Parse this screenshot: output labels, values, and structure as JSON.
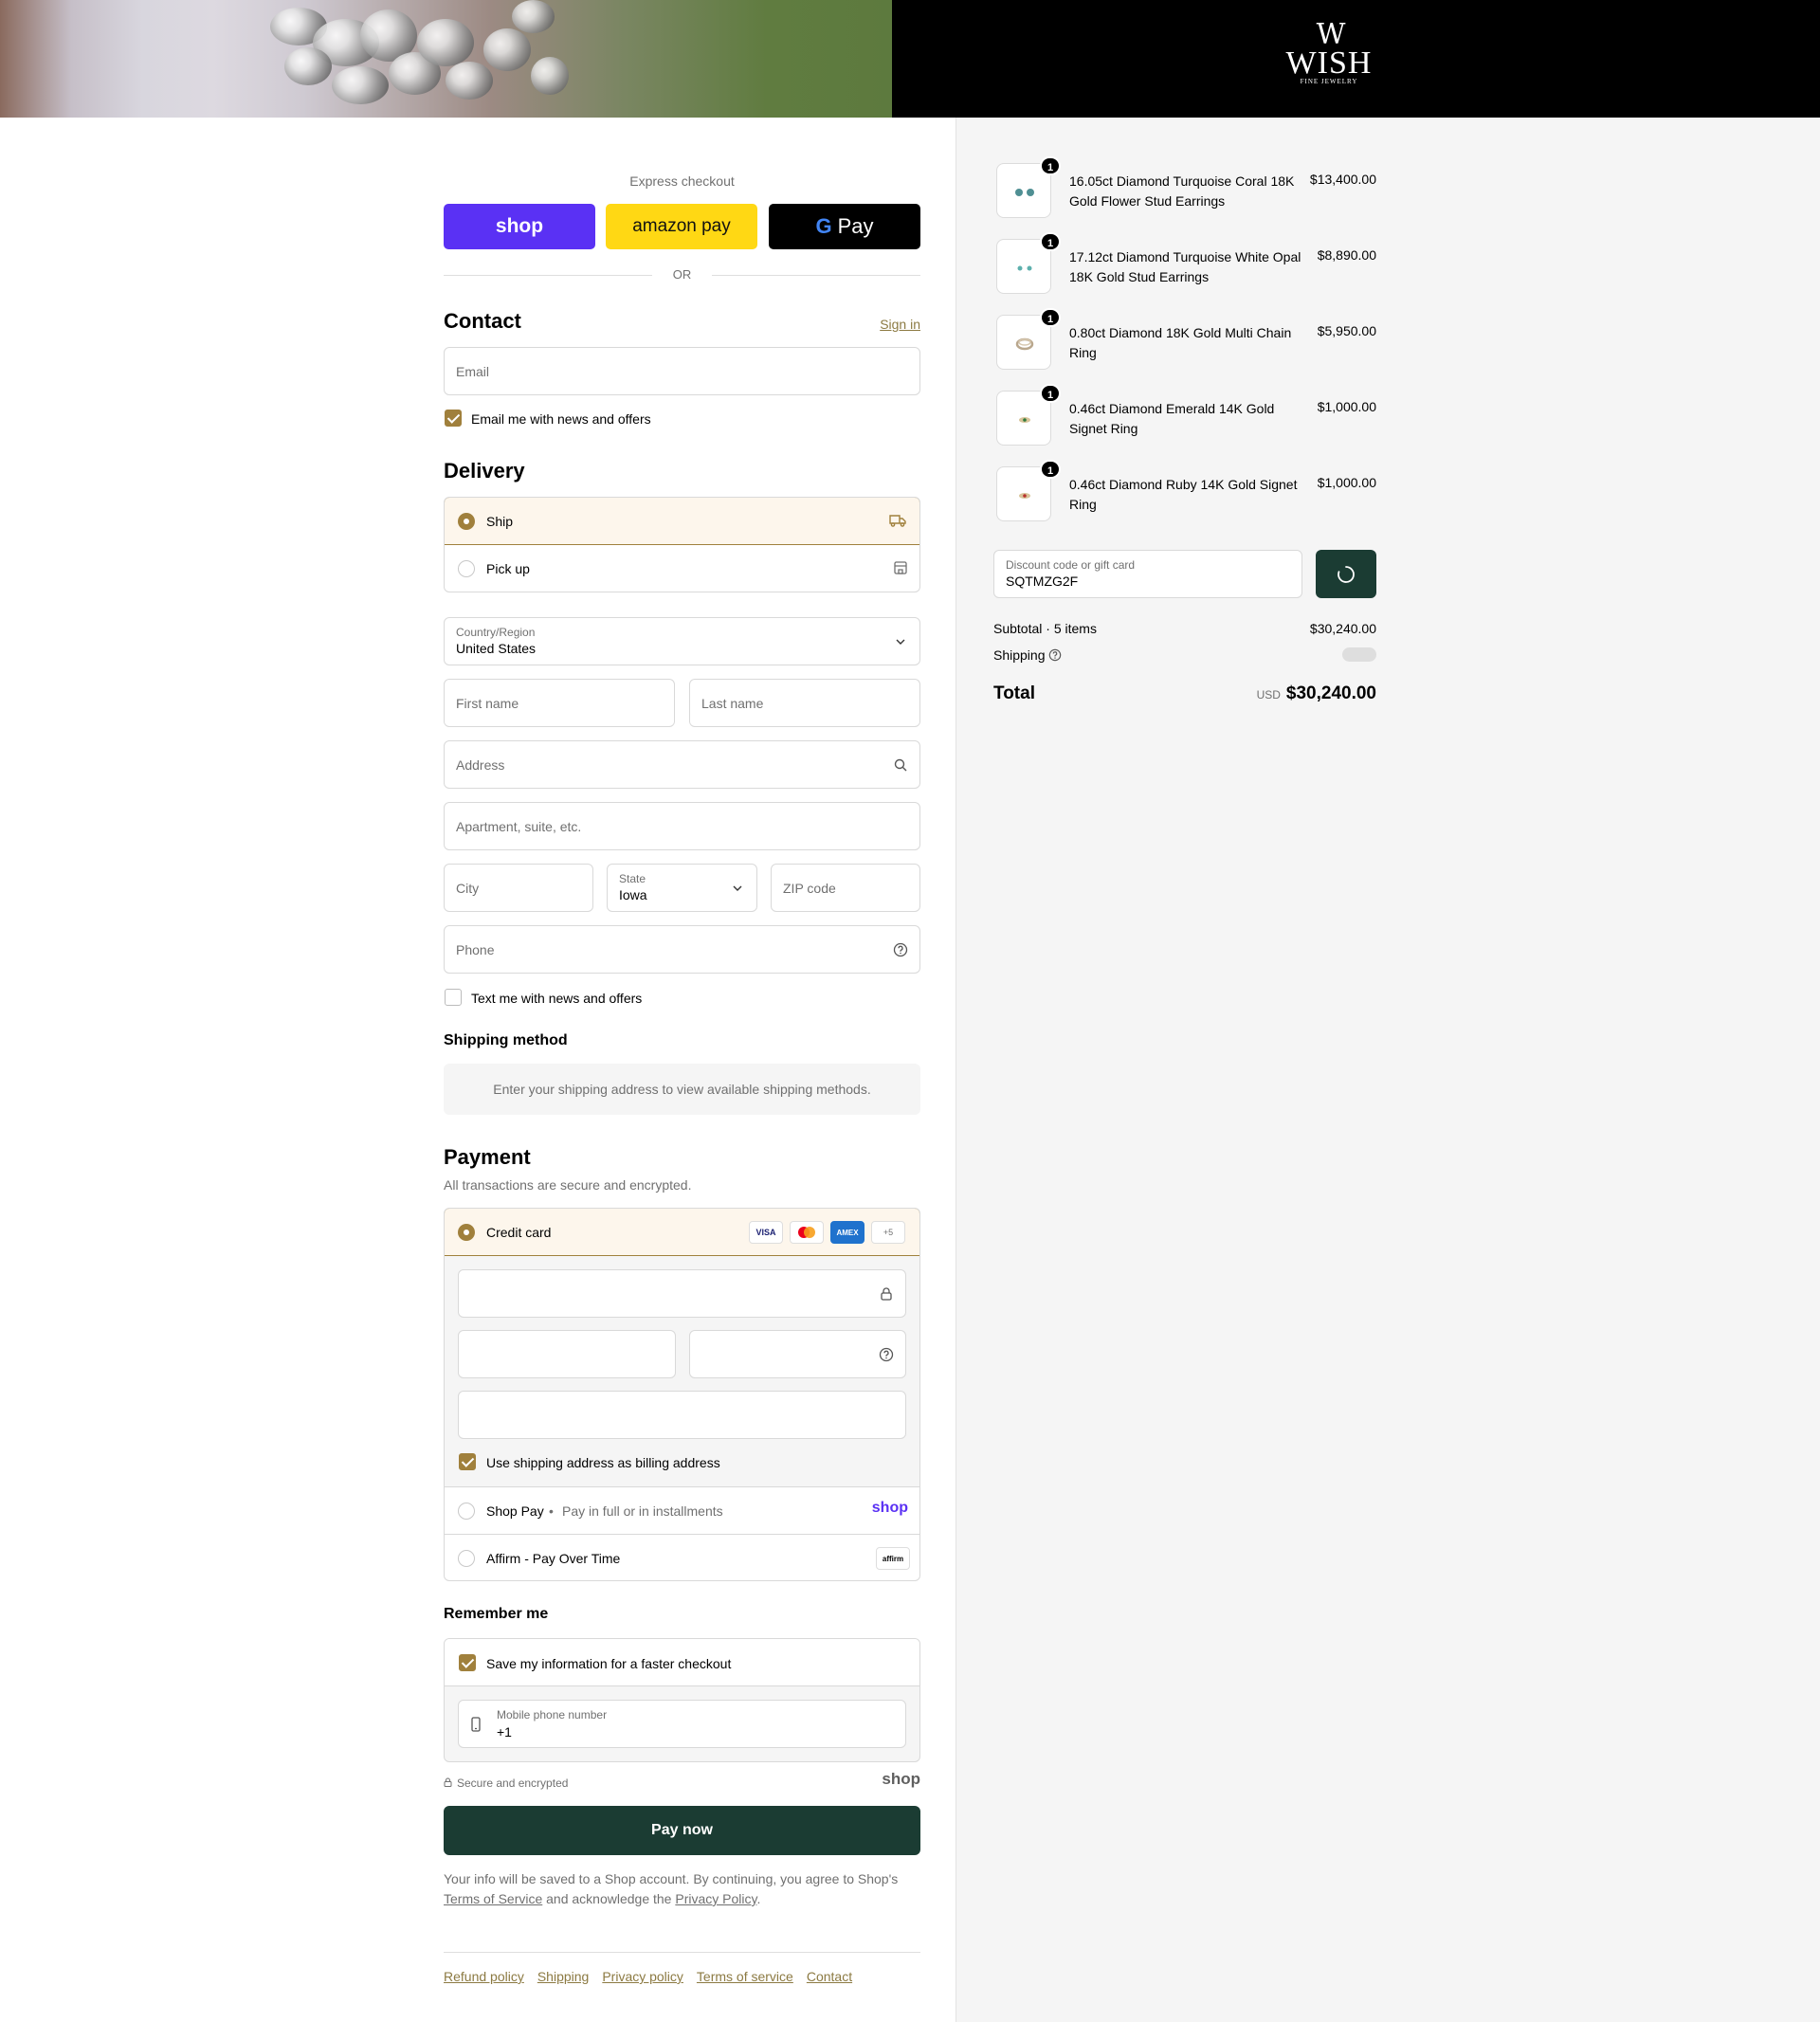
{
  "brand": {
    "logo_mark": "W",
    "logo_word": "WISH",
    "logo_sub": "FINE JEWELRY"
  },
  "express": {
    "title": "Express checkout",
    "shop_label": "shop",
    "amazon_label": "amazon pay",
    "gpay_label": "Pay",
    "or_label": "OR"
  },
  "contact": {
    "title": "Contact",
    "sign_in": "Sign in",
    "email_placeholder": "Email",
    "news_label": "Email me with news and offers"
  },
  "delivery": {
    "title": "Delivery",
    "options": [
      {
        "label": "Ship",
        "selected": true
      },
      {
        "label": "Pick up",
        "selected": false
      }
    ],
    "country_label": "Country/Region",
    "country_value": "United States",
    "first_name": "First name",
    "last_name": "Last name",
    "address": "Address",
    "apartment": "Apartment, suite, etc.",
    "city": "City",
    "state_label": "State",
    "state_value": "Iowa",
    "zip": "ZIP code",
    "phone": "Phone",
    "text_label": "Text me with news and offers"
  },
  "shipping_method": {
    "title": "Shipping method",
    "notice": "Enter your shipping address to view available shipping methods."
  },
  "payment": {
    "title": "Payment",
    "subtitle": "All transactions are secure and encrypted.",
    "credit_card_label": "Credit card",
    "card_brands": [
      "VISA",
      "MC",
      "AMEX",
      "+5"
    ],
    "billing_label": "Use shipping address as billing address",
    "shop_pay_label": "Shop Pay",
    "shop_pay_note": "Pay in full or in installments",
    "shop_pay_logo": "shop",
    "affirm_label": "Affirm - Pay Over Time",
    "affirm_logo": "affirm"
  },
  "remember": {
    "title": "Remember me",
    "save_label": "Save my information for a faster checkout",
    "mobile_label": "Mobile phone number",
    "mobile_value": "+1",
    "secure_label": "Secure and encrypted",
    "shop_logo": "shop"
  },
  "pay_now": "Pay now",
  "legal": {
    "text_1": "Your info will be saved to a Shop account. By continuing, you agree to Shop's",
    "terms": "Terms of Service",
    "text_2": "and acknowledge the",
    "privacy": "Privacy Policy",
    "text_3": "."
  },
  "footer_links": [
    "Refund policy",
    "Shipping",
    "Privacy policy",
    "Terms of service",
    "Contact"
  ],
  "order": {
    "items": [
      {
        "qty": "1",
        "name": "16.05ct Diamond Turquoise Coral 18K Gold Flower Stud Earrings",
        "price": "$13,400.00"
      },
      {
        "qty": "1",
        "name": "17.12ct Diamond Turquoise White Opal 18K Gold Stud Earrings",
        "price": "$8,890.00"
      },
      {
        "qty": "1",
        "name": "0.80ct Diamond 18K Gold Multi Chain Ring",
        "price": "$5,950.00"
      },
      {
        "qty": "1",
        "name": "0.46ct Diamond Emerald 14K Gold Signet Ring",
        "price": "$1,000.00"
      },
      {
        "qty": "1",
        "name": "0.46ct Diamond Ruby 14K Gold Signet Ring",
        "price": "$1,000.00"
      }
    ],
    "discount_label": "Discount code or gift card",
    "discount_value": "SQTMZG2F",
    "subtotal_label": "Subtotal · 5 items",
    "subtotal_value": "$30,240.00",
    "shipping_label": "Shipping",
    "total_label": "Total",
    "currency": "USD",
    "total_value": "$30,240.00"
  },
  "colors": {
    "accent": "#a0803c",
    "pay_button": "#1b3c33",
    "shop_purple": "#5a31f4",
    "amazon_yellow": "#ffd814",
    "selected_bg": "#fdf6ec"
  }
}
